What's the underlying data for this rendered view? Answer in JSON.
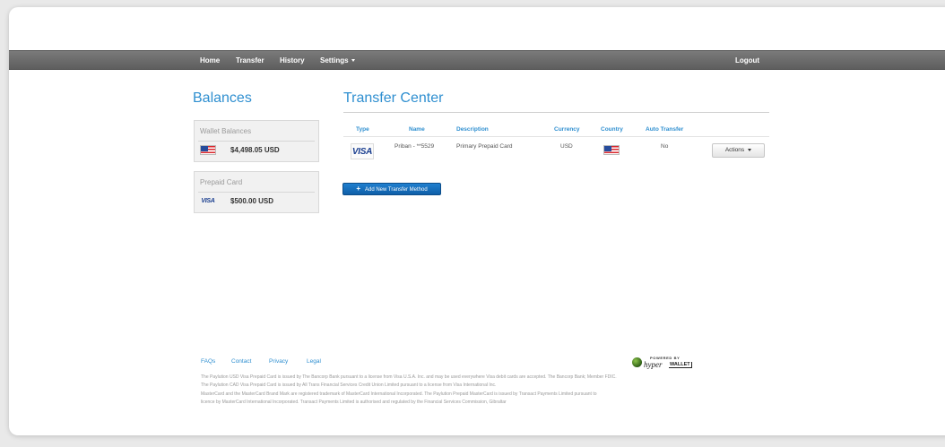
{
  "nav": {
    "home": "Home",
    "transfer": "Transfer",
    "history": "History",
    "settings": "Settings",
    "logout": "Logout"
  },
  "balances": {
    "title": "Balances",
    "wallet": {
      "label": "Wallet Balances",
      "amount": "$4,498.05 USD",
      "icon": "us-flag-icon"
    },
    "prepaid": {
      "label": "Prepaid Card",
      "amount": "$500.00 USD",
      "icon": "visa-icon",
      "card_brand": "VISA"
    }
  },
  "transfer_center": {
    "title": "Transfer Center",
    "columns": [
      "Type",
      "Name",
      "Description",
      "Currency",
      "Country",
      "Auto Transfer"
    ],
    "rows": [
      {
        "type": "VISA",
        "name": "Priban - **5529",
        "description": "Primary Prepaid Card",
        "currency": "USD",
        "country_icon": "us-flag-icon",
        "auto_transfer": "No",
        "actions_label": "Actions"
      }
    ],
    "add_button": "Add New Transfer Method"
  },
  "footer": {
    "links": [
      "FAQs",
      "Contact",
      "Privacy",
      "Legal"
    ],
    "disclaimer": [
      "The Paylution USD Visa Prepaid Card is issued by The Bancorp Bank pursuant to a license from Visa U.S.A. Inc. and may be used everywhere Visa debit cards are accepted. The Bancorp Bank; Member FDIC.",
      "The Paylution CAD Visa Prepaid Card is issued by All Trans Financial Services Credit Union Limited pursuant to a license from Visa International Inc.",
      "MasterCard and the MasterCard Brand Mark are registered trademark of MasterCard International Incorporated. The Paylution Prepaid MasterCard is issued by Transact Payments Limited pursuant to",
      "licence by MasterCard International Incorporated. Transact Payments Limited is authorised and regulated by the Financial Services Commission, Gibraltar"
    ],
    "logo": {
      "powered": "POWERED BY",
      "hyper": "hyper",
      "wallet": "WALLET"
    }
  },
  "colors": {
    "accent": "#2f8fd0",
    "nav_bg": "#6b6b6b",
    "button_blue": "#1470bd"
  }
}
